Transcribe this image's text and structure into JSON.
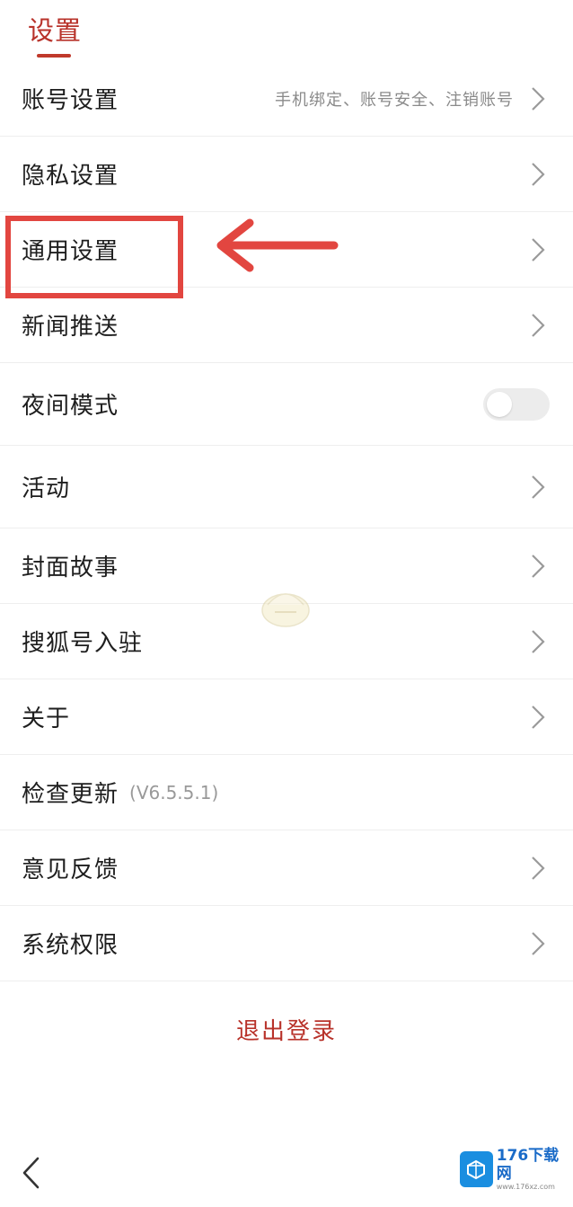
{
  "header": {
    "tab_label": "设置"
  },
  "settings": {
    "items": [
      {
        "label": "账号设置",
        "sub": "手机绑定、账号安全、注销账号"
      },
      {
        "label": "隐私设置"
      },
      {
        "label": "通用设置"
      },
      {
        "label": "新闻推送"
      },
      {
        "label": "夜间模式",
        "toggle_on": false
      },
      {
        "label": "活动"
      },
      {
        "label": "封面故事"
      },
      {
        "label": "搜狐号入驻"
      },
      {
        "label": "关于"
      },
      {
        "label": "检查更新",
        "version": "(V6.5.5.1)"
      },
      {
        "label": "意见反馈"
      },
      {
        "label": "系统权限"
      }
    ]
  },
  "logout": {
    "label": "退出登录"
  },
  "watermark": {
    "brand_name": "176下载网",
    "brand_url": "www.176xz.com"
  },
  "colors": {
    "accent": "#b8322a",
    "annotation": "#e24640",
    "toggle_track": "#ececec"
  },
  "icons": {
    "chevron": "chevron-right-icon",
    "back": "back-arrow-icon"
  }
}
